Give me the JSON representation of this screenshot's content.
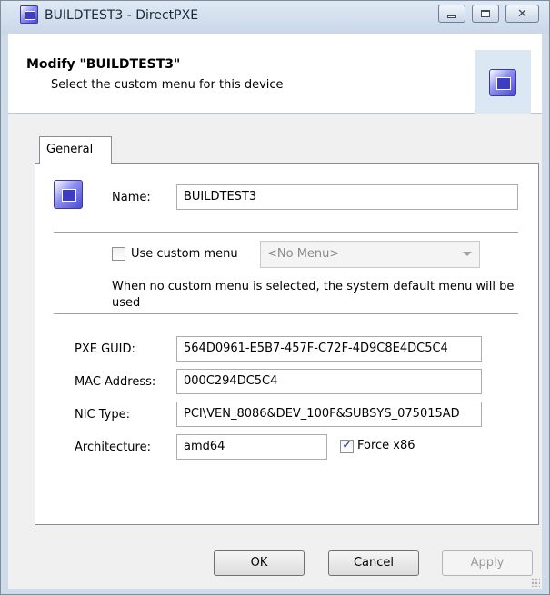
{
  "window": {
    "title": "BUILDTEST3 - DirectPXE"
  },
  "header": {
    "title": "Modify \"BUILDTEST3\"",
    "subtitle": "Select the custom menu for this device"
  },
  "tabs": [
    {
      "label": "General",
      "active": true
    }
  ],
  "general": {
    "name_label": "Name:",
    "name_value": "BUILDTEST3",
    "custom_menu_label": "Use custom menu",
    "custom_menu_checked": false,
    "custom_menu_selected": "<No Menu>",
    "info_text": "When no custom menu is selected, the system default menu will be used",
    "pxe_guid_label": "PXE GUID:",
    "pxe_guid_value": "564D0961-E5B7-457F-C72F-4D9C8E4DC5C4",
    "mac_label": "MAC Address:",
    "mac_value": "000C294DC5C4",
    "nic_label": "NIC Type:",
    "nic_value": "PCI\\VEN_8086&DEV_100F&SUBSYS_075015AD",
    "arch_label": "Architecture:",
    "arch_value": "amd64",
    "force_x86_label": "Force x86",
    "force_x86_checked": true
  },
  "buttons": {
    "ok": "OK",
    "cancel": "Cancel",
    "apply": "Apply",
    "apply_enabled": false
  },
  "icons": [
    "app-icon",
    "minimize-icon",
    "maximize-icon",
    "close-icon",
    "device-icon",
    "dropdown-arrow-icon",
    "resize-grip-icon"
  ]
}
